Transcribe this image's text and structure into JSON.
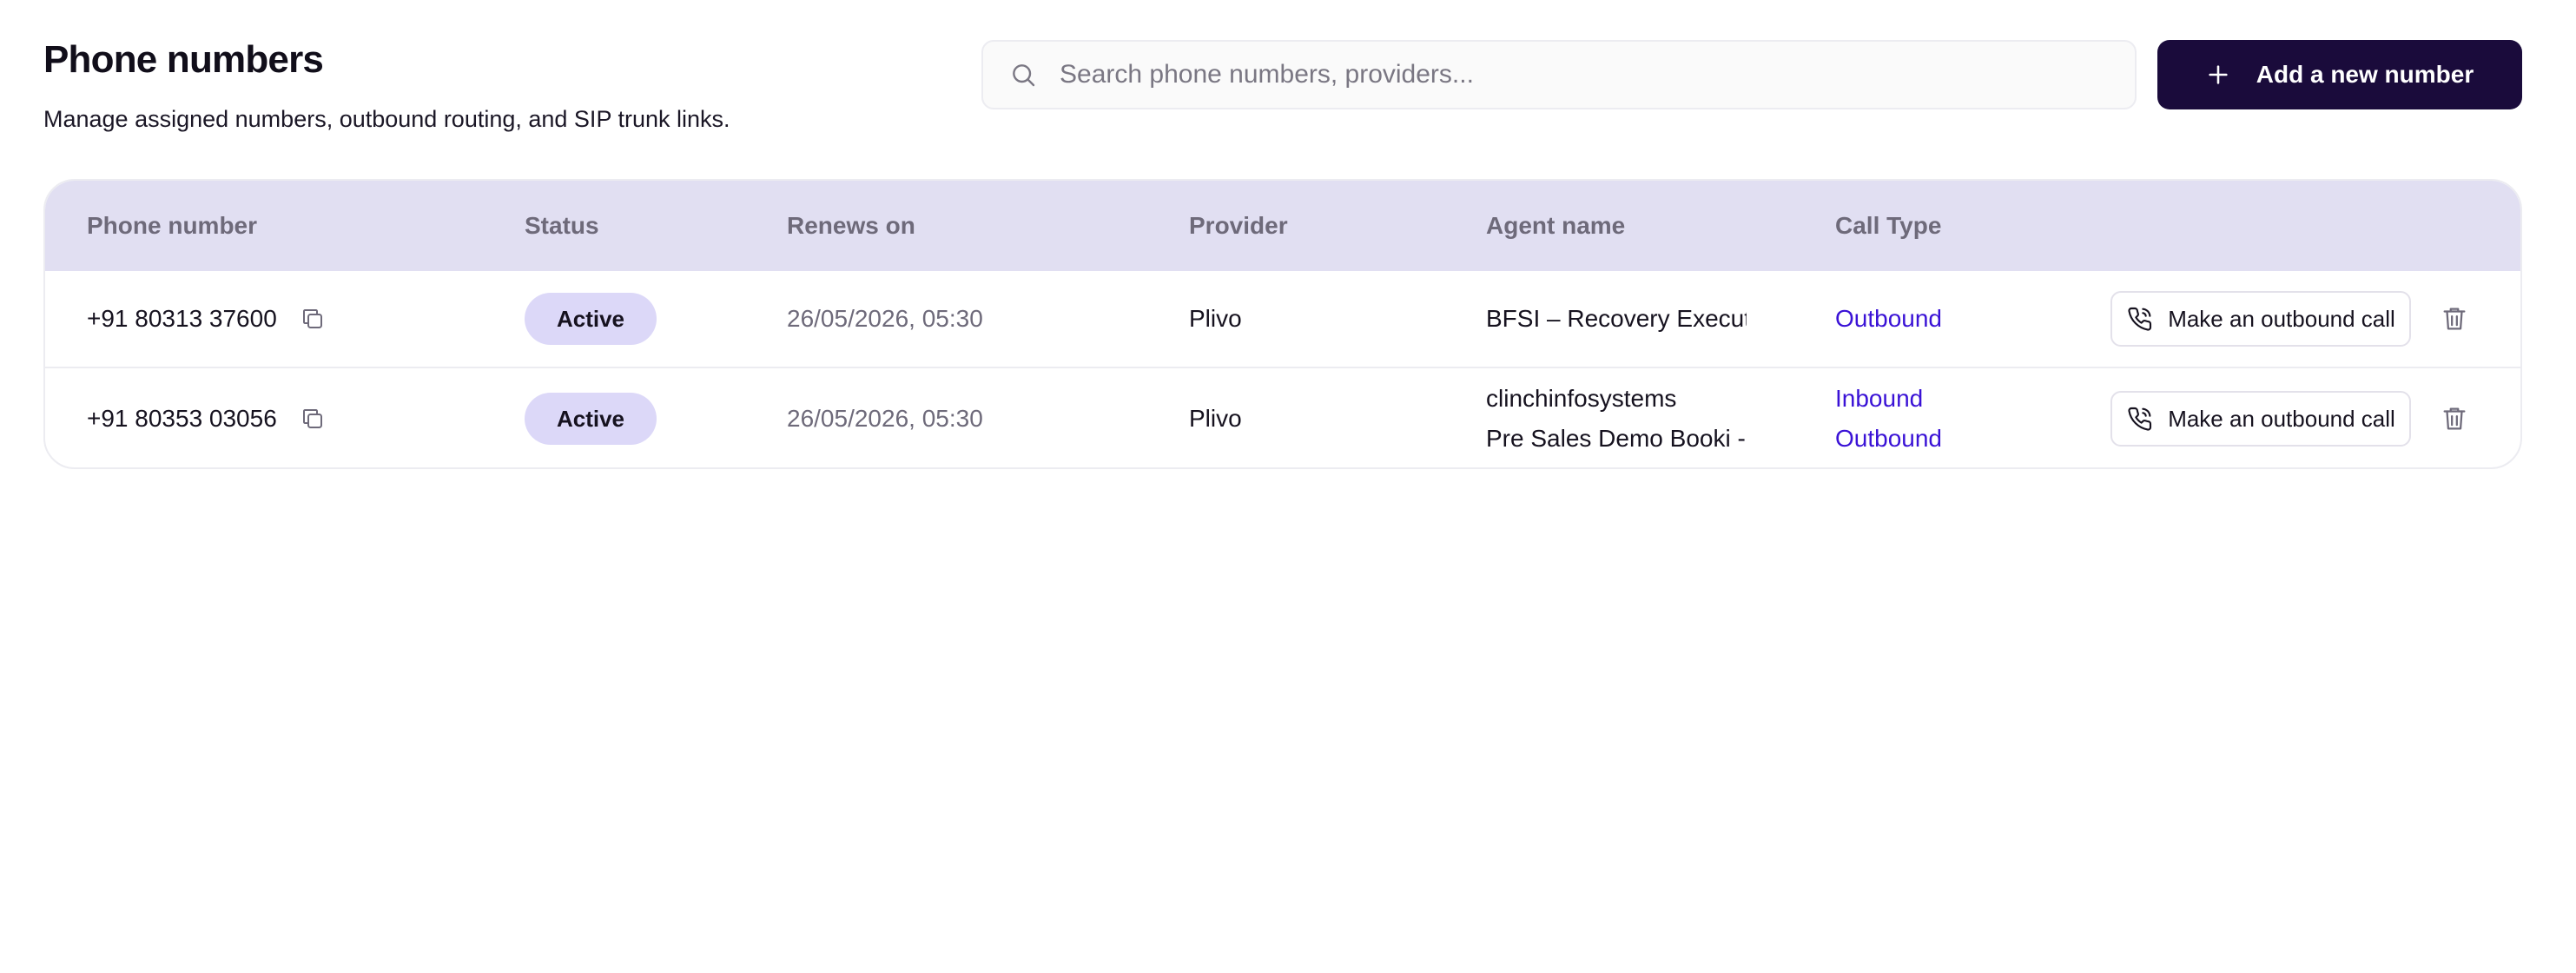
{
  "header": {
    "title": "Phone numbers",
    "subtitle": "Manage assigned numbers, outbound routing, and SIP trunk links."
  },
  "search": {
    "placeholder": "Search phone numbers, providers...",
    "value": "",
    "icon": "search-icon"
  },
  "add_button": {
    "label": "Add a new number",
    "icon": "plus-icon"
  },
  "table": {
    "columns": [
      "Phone number",
      "Status",
      "Renews on",
      "Provider",
      "Agent name",
      "Call Type"
    ],
    "rows": [
      {
        "phone": "+91 80313 37600",
        "status": "Active",
        "renews_on": "26/05/2026, 05:30",
        "provider": "Plivo",
        "agents": [
          "BFSI – Recovery Executi..."
        ],
        "call_types": [
          "Outbound"
        ],
        "action_label": "Make an outbound call"
      },
      {
        "phone": "+91 80353 03056",
        "status": "Active",
        "renews_on": "26/05/2026, 05:30",
        "provider": "Plivo",
        "agents": [
          "clinchinfosystems",
          "Pre Sales Demo Booki - ..."
        ],
        "call_types": [
          "Inbound",
          "Outbound"
        ],
        "action_label": "Make an outbound call"
      }
    ]
  },
  "colors": {
    "primary_button": "#1a0b3b",
    "table_header_bg": "#e1dff2",
    "status_badge_bg": "#dcd8f8",
    "call_type_text": "#3a12d6"
  }
}
